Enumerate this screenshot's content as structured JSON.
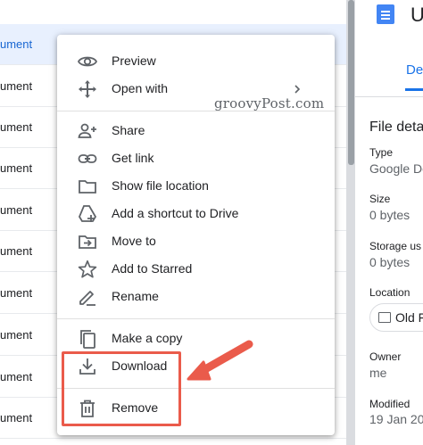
{
  "file_list": {
    "rows": [
      {
        "name": "ument",
        "selected": true
      },
      {
        "name": "ument"
      },
      {
        "name": "ument"
      },
      {
        "name": "ument"
      },
      {
        "name": "ument"
      },
      {
        "name": "ument"
      },
      {
        "name": "ument"
      },
      {
        "name": "ument"
      },
      {
        "name": "ument"
      },
      {
        "name": "ument"
      }
    ]
  },
  "context_menu": {
    "items": [
      {
        "label": "Preview",
        "icon": "eye-icon"
      },
      {
        "label": "Open with",
        "icon": "move-arrows-icon",
        "has_submenu": true
      },
      {
        "label": "Share",
        "icon": "person-add-icon"
      },
      {
        "label": "Get link",
        "icon": "link-icon"
      },
      {
        "label": "Show file location",
        "icon": "folder-icon"
      },
      {
        "label": "Add a shortcut to Drive",
        "icon": "drive-shortcut-icon"
      },
      {
        "label": "Move to",
        "icon": "folder-move-icon"
      },
      {
        "label": "Add to Starred",
        "icon": "star-icon"
      },
      {
        "label": "Rename",
        "icon": "pencil-icon"
      },
      {
        "label": "Make a copy",
        "icon": "copy-icon"
      },
      {
        "label": "Download",
        "icon": "download-icon"
      },
      {
        "label": "Remove",
        "icon": "trash-icon"
      }
    ]
  },
  "watermark": "groovyPost.com",
  "details_panel": {
    "title_fragment": "U",
    "tab_fragment": "Det",
    "section_title": "File deta",
    "fields": [
      {
        "key": "Type",
        "value": "Google Do"
      },
      {
        "key": "Size",
        "value": "0 bytes"
      },
      {
        "key": "Storage us",
        "value": "0 bytes"
      },
      {
        "key": "Location",
        "value": "Old F"
      },
      {
        "key": "Owner",
        "value": "me"
      },
      {
        "key": "Modified",
        "value": "19 Jan 20"
      }
    ]
  },
  "colors": {
    "accent": "#1a73e8",
    "selected_row": "#e8f0fe",
    "annotation": "#ea5b4b",
    "icon": "#5f6368"
  }
}
